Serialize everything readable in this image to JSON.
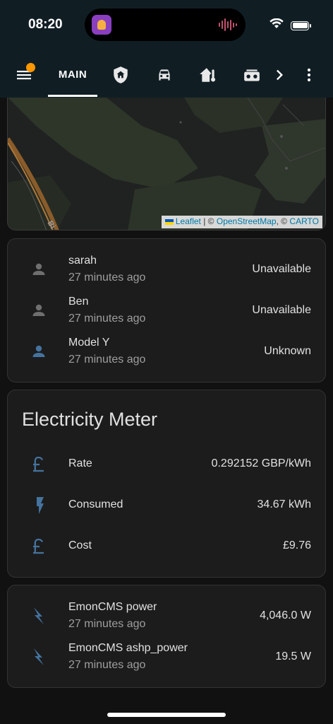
{
  "status": {
    "time": "08:20",
    "icons": [
      "wifi-icon",
      "battery-icon"
    ]
  },
  "toolbar": {
    "menu_icon": "hamburger-menu-icon",
    "active_tab": "MAIN",
    "tab_icons": [
      "shield-home-icon",
      "car-icon",
      "home-thermometer-icon",
      "radio-icon"
    ],
    "more_tabs_icon": "chevron-right-icon",
    "overflow_icon": "dots-vertical-icon",
    "badge_color": "#ff9800"
  },
  "map": {
    "attribution": {
      "leaflet": "Leaflet",
      "sep1": " | © ",
      "osm": "OpenStreetMap",
      "sep2": ", © ",
      "carto": "CARTO"
    },
    "road_label": "Bi"
  },
  "people": [
    {
      "name": "sarah",
      "sub": "27 minutes ago",
      "state": "Unavailable",
      "icon": "account-icon",
      "icon_color": "#6f6f6f"
    },
    {
      "name": "Ben",
      "sub": "27 minutes ago",
      "state": "Unavailable",
      "icon": "account-icon",
      "icon_color": "#6f6f6f"
    },
    {
      "name": "Model Y",
      "sub": "27 minutes ago",
      "state": "Unknown",
      "icon": "account-icon",
      "icon_color": "#44739e"
    }
  ],
  "electricity": {
    "title": "Electricity Meter",
    "rows": [
      {
        "name": "Rate",
        "value": "0.292152 GBP/kWh",
        "icon": "currency-gbp-icon"
      },
      {
        "name": "Consumed",
        "value": "34.67 kWh",
        "icon": "flash-icon"
      },
      {
        "name": "Cost",
        "value": "£9.76",
        "icon": "currency-gbp-icon"
      }
    ]
  },
  "emon": [
    {
      "name": "EmonCMS power",
      "sub": "27 minutes ago",
      "value": "4,046.0 W",
      "icon": "flash-icon"
    },
    {
      "name": "EmonCMS ashp_power",
      "sub": "27 minutes ago",
      "value": "19.5 W",
      "icon": "flash-icon"
    }
  ],
  "colors": {
    "header_bg": "#101e24",
    "card_bg": "#1c1c1c",
    "accent_icon": "#44739e"
  }
}
